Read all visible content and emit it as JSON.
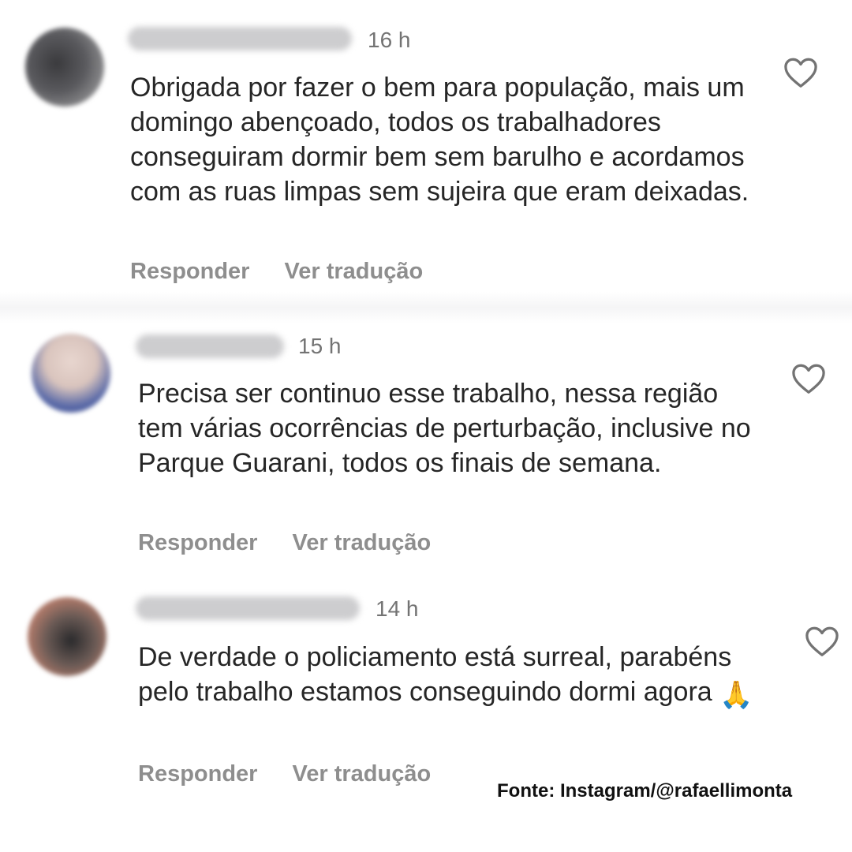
{
  "comments": [
    {
      "time": "16 h",
      "text": "Obrigada por fazer o bem para população, mais um domingo abençoado, todos os trabalhadores conseguiram dormir bem sem barulho e acordamos com as ruas limpas sem sujeira que eram deixadas.",
      "reply_label": "Responder",
      "translate_label": "Ver tradução",
      "like_icon": "heart-outline-icon"
    },
    {
      "time": "15 h",
      "text": "Precisa ser continuo esse trabalho, nessa região tem várias ocorrências de perturbação, inclusive no Parque Guarani, todos os finais de semana.",
      "reply_label": "Responder",
      "translate_label": "Ver tradução",
      "like_icon": "heart-outline-icon"
    },
    {
      "time": "14 h",
      "text": "De verdade o policiamento está surreal, parabéns pelo trabalho estamos conseguindo dormi agora",
      "emoji": "🙏",
      "reply_label": "Responder",
      "translate_label": "Ver tradução",
      "like_icon": "heart-outline-icon"
    }
  ],
  "source": "Fonte: Instagram/@rafaellimonta",
  "colors": {
    "text": "#262626",
    "meta": "#737373",
    "action": "#8e8e8e",
    "heart_outline": "#737373"
  }
}
